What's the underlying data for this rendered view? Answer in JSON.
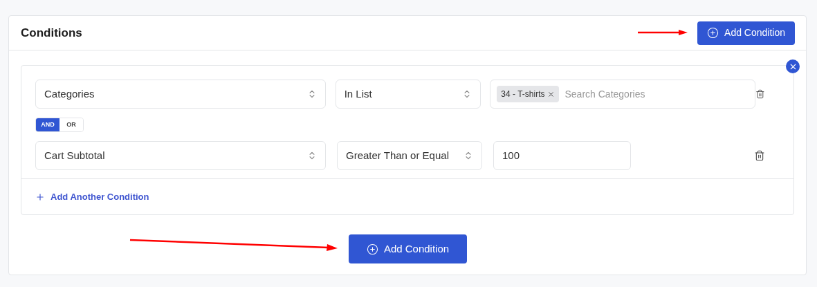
{
  "card": {
    "title": "Conditions",
    "header_button": "Add Condition"
  },
  "conditions": [
    {
      "field": "Categories",
      "operator": "In List",
      "kind": "tags",
      "tags": [
        "34 - T-shirts"
      ],
      "placeholder": "Search Categories"
    },
    {
      "field": "Cart Subtotal",
      "operator": "Greater Than or Equal",
      "kind": "text",
      "value": "100"
    }
  ],
  "connector": [
    {
      "label": "AND",
      "selected": true
    },
    {
      "label": "OR",
      "selected": false
    }
  ],
  "add_another": "Add Another Condition",
  "footer_button": "Add Condition"
}
